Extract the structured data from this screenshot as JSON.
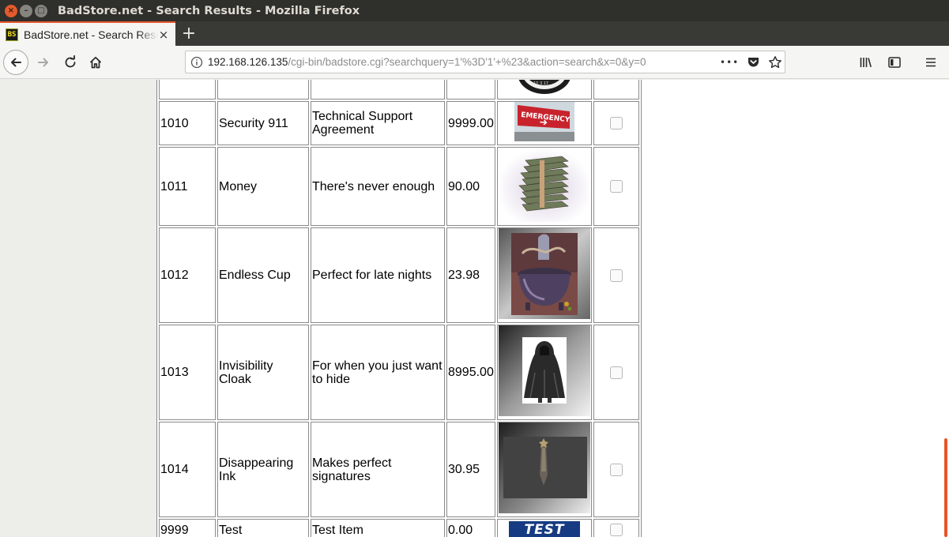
{
  "window": {
    "title": "BadStore.net - Search Results - Mozilla Firefox"
  },
  "tab": {
    "favicon_text": "BS",
    "title": "BadStore.net - Search Results",
    "close": "×",
    "new_tab": "+"
  },
  "nav": {
    "url_main": "192.168.126.135",
    "url_rest": "/cgi-bin/badstore.cgi?searchquery=1'%3D'1'+%23&action=search&x=0&y=0",
    "more": "•••"
  },
  "colors": {
    "accent": "#e5562b",
    "titlebar": "#2f2f2c",
    "page_side": "#ededea"
  },
  "products": [
    {
      "id": "",
      "name": "",
      "description": "",
      "price": "",
      "image": "clock-image"
    },
    {
      "id": "1010",
      "name": "Security 911",
      "description": "Technical Support Agreement",
      "price": "9999.00",
      "image": "emergency-sign-image"
    },
    {
      "id": "1011",
      "name": "Money",
      "description": "There's never enough",
      "price": "90.00",
      "image": "money-stack-image"
    },
    {
      "id": "1012",
      "name": "Endless Cup",
      "description": "Perfect for late nights",
      "price": "23.98",
      "image": "cauldron-cup-image"
    },
    {
      "id": "1013",
      "name": "Invisibility Cloak",
      "description": "For when you just want to hide",
      "price": "8995.00",
      "image": "cloak-image"
    },
    {
      "id": "1014",
      "name": "Disappearing Ink",
      "description": "Makes perfect signatures",
      "price": "30.95",
      "image": "ink-pen-image"
    },
    {
      "id": "9999",
      "name": "Test",
      "description": "Test Item",
      "price": "0.00",
      "image": "test-banner-image",
      "image_text": "TEST"
    }
  ]
}
